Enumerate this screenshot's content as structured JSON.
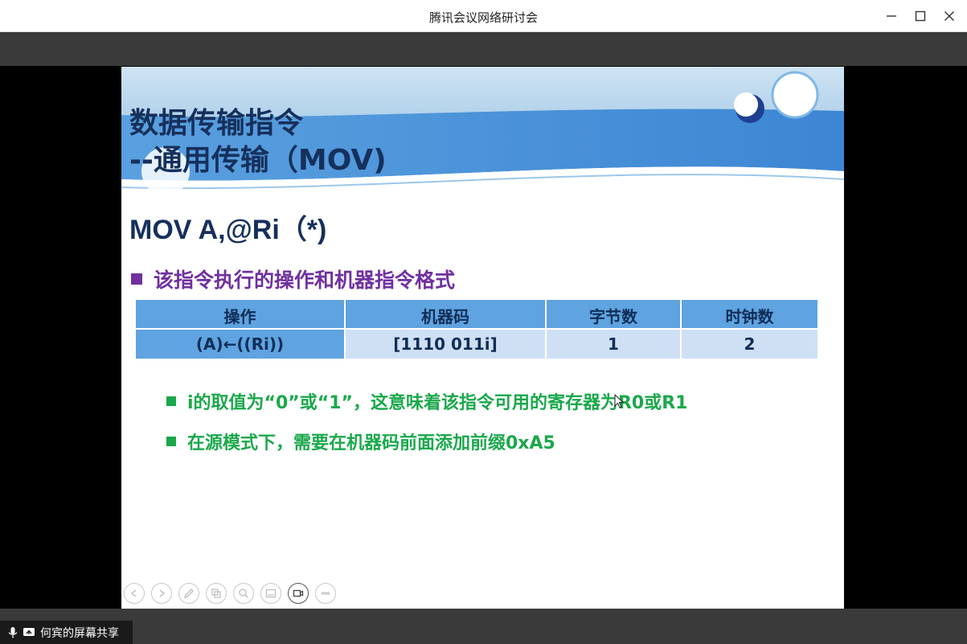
{
  "window": {
    "title": "腾讯会议网络研讨会"
  },
  "slide": {
    "title_line1": "数据传输指令",
    "title_line2": "--通用传输（MOV)",
    "instruction": "MOV A,@Ri（*)",
    "heading": "该指令执行的操作和机器指令格式",
    "table": {
      "headers": [
        "操作",
        "机器码",
        "字节数",
        "时钟数"
      ],
      "row": [
        "(A)←((Ri))",
        "[1110 011i]",
        "1",
        "2"
      ]
    },
    "notes": [
      "i的取值为“0”或“1”，这意味着该指令可用的寄存器为R0或R1",
      "在源模式下，需要在机器码前面添加前缀0xA5"
    ],
    "colors": {
      "title": "#16305c",
      "heading": "#7030a0",
      "notes": "#1aa84b",
      "table_header": "#5fa3e0",
      "table_cell": "#cfe0f5"
    }
  },
  "share_bar": {
    "label": "何宾的屏幕共享",
    "icons": [
      "microphone-icon",
      "screen-share-icon"
    ]
  }
}
